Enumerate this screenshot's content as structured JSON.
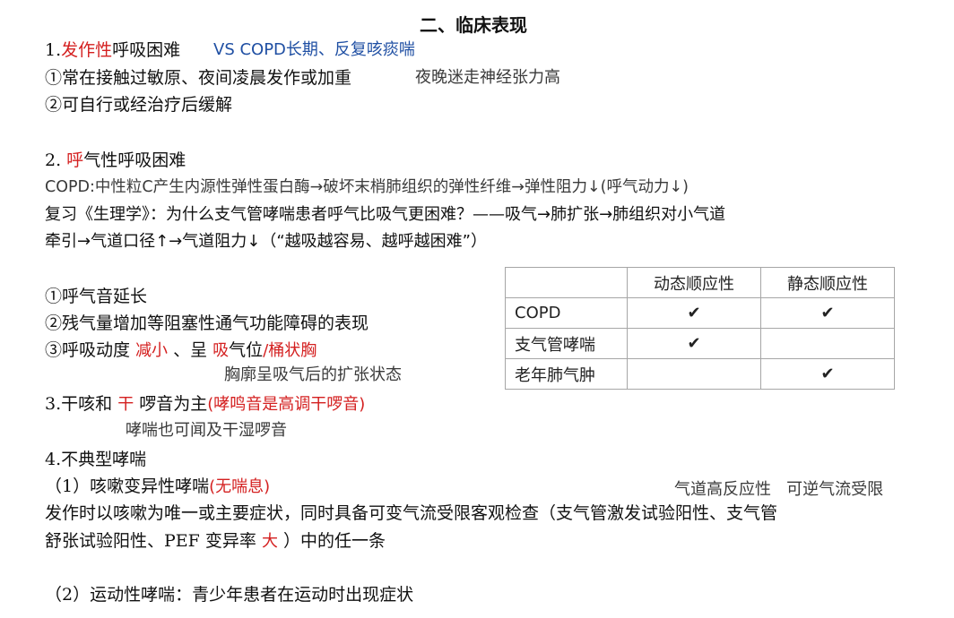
{
  "title": "二、临床表现",
  "s1": {
    "num": "1.",
    "hl": "发作性",
    "rest": "呼吸困难",
    "vs": "VS  COPD长期、反复咳痰喘",
    "p1": "①常在接触过敏原、夜间凌晨发作或加重",
    "p1_note": "夜晚迷走神经张力高",
    "p2": "②可自行或经治疗后缓解"
  },
  "s2": {
    "num": "2. ",
    "hl": "呼",
    "rest": "气性呼吸困难",
    "copd": "COPD:中性粒C产生内源性弹性蛋白酶→破坏末梢肺组织的弹性纤维→弹性阻力↓(呼气动力↓)",
    "review1": "复习《生理学》：为什么支气管哮喘患者呼气比吸气更困难？——吸气→肺扩张→肺组织对小气道",
    "review2": "牵引→气道口径↑→气道阻力↓（“越吸越容易、越呼越困难”）",
    "p1": "①呼气音延长",
    "p2": "②残气量增加等阻塞性通气功能障碍的表现",
    "p3a": "③呼吸动度",
    "p3b": "减小",
    "p3c": "、呈",
    "p3d": "吸",
    "p3e": "气位",
    "p3f": "/桶状胸",
    "p3_note": "胸廓呈吸气后的扩张状态"
  },
  "table": {
    "headers": [
      "",
      "动态顺应性",
      "静态顺应性"
    ],
    "rows": [
      {
        "label": "COPD",
        "dyn": "✔",
        "sta": "✔"
      },
      {
        "label": "支气管哮喘",
        "dyn": "✔",
        "sta": ""
      },
      {
        "label": "老年肺气肿",
        "dyn": "",
        "sta": "✔"
      }
    ]
  },
  "s3": {
    "a": "3.干咳和",
    "b": "干",
    "c": "啰音为主",
    "d": "(哮鸣音是高调干啰音)",
    "note": "哮喘也可闻及干湿啰音"
  },
  "s4": {
    "title": "4.不典型哮喘",
    "sub1a": "（1）咳嗽变异性哮喘",
    "sub1b": "(无喘息)",
    "side_note": "气道高反应性   可逆气流受限",
    "desc1": "发作时以咳嗽为唯一或主要症状，同时具备可变气流受限客观检查（支气管激发试验阳性、支气管",
    "desc2a": "舒张试验阳性、PEF 变异率",
    "desc2b": "大",
    "desc2c": "）中的任一条",
    "sub2": "（2）运动性哮喘：青少年患者在运动时出现症状"
  }
}
